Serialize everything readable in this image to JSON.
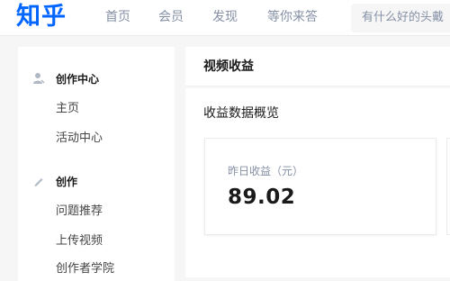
{
  "topbar": {
    "logo": "知乎",
    "nav": [
      "首页",
      "会员",
      "发现",
      "等你来答"
    ],
    "search_placeholder": "有什么好的头戴"
  },
  "sidebar": {
    "sections": [
      {
        "title": "创作中心",
        "icon": "person-icon",
        "items": [
          "主页",
          "活动中心"
        ]
      },
      {
        "title": "创作",
        "icon": "pencil-icon",
        "items": [
          "问题推荐",
          "上传视频",
          "创作者学院"
        ]
      }
    ]
  },
  "main": {
    "title": "视频收益",
    "section_title": "收益数据概览",
    "card": {
      "label": "昨日收益（元）",
      "value": "89.02"
    }
  },
  "colors": {
    "brand": "#0066ff",
    "muted": "#8590a6",
    "background": "#f6f6f6"
  }
}
